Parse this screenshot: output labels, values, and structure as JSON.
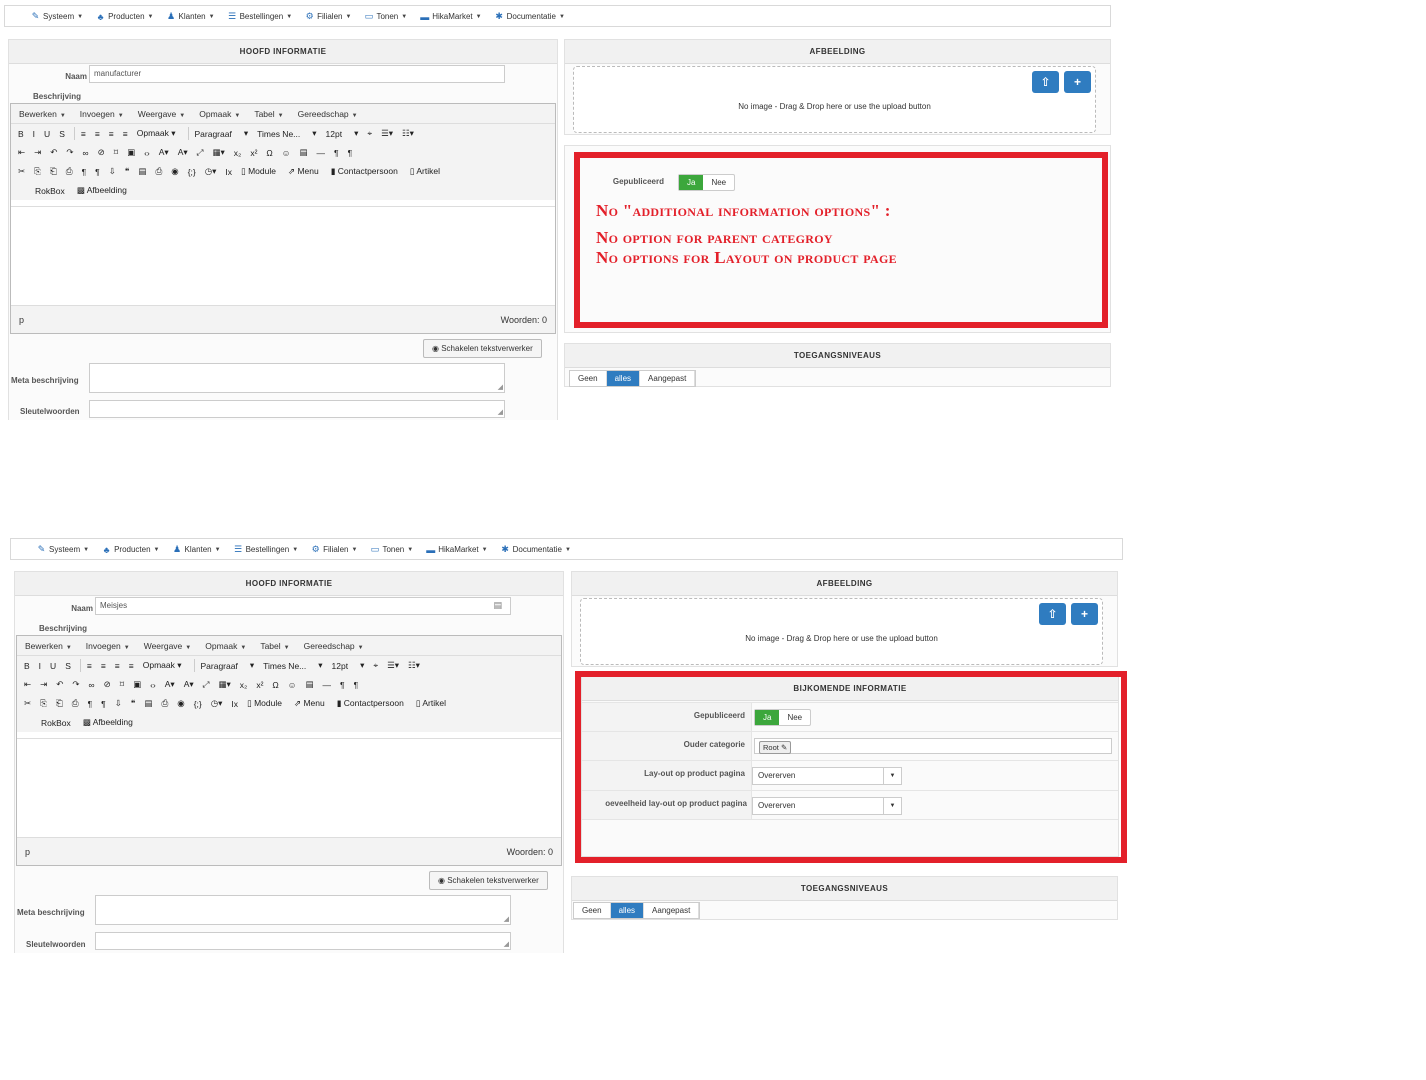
{
  "nav": [
    {
      "label": "Systeem",
      "icon": "wrench-icon",
      "glyph": "✎"
    },
    {
      "label": "Producten",
      "icon": "cubes-icon",
      "glyph": "♣"
    },
    {
      "label": "Klanten",
      "icon": "user-icon",
      "glyph": "♟"
    },
    {
      "label": "Bestellingen",
      "icon": "orders-icon",
      "glyph": "☰"
    },
    {
      "label": "Filialen",
      "icon": "stores-icon",
      "glyph": "⚙"
    },
    {
      "label": "Tonen",
      "icon": "monitor-icon",
      "glyph": "▭"
    },
    {
      "label": "HikaMarket",
      "icon": "market-icon",
      "glyph": "▬"
    },
    {
      "label": "Documentatie",
      "icon": "help-icon",
      "glyph": "✱"
    }
  ],
  "editor": {
    "menu": [
      "Bewerken",
      "Invoegen",
      "Weergave",
      "Opmaak",
      "Tabel",
      "Gereedschap"
    ],
    "row1": [
      {
        "g": "B",
        "n": "bold-icon"
      },
      {
        "g": "I",
        "n": "italic-icon"
      },
      {
        "g": "U",
        "n": "underline-icon"
      },
      {
        "g": "S",
        "n": "strikethrough-icon"
      },
      {
        "sep": true
      },
      {
        "g": "≡",
        "n": "align-left-icon"
      },
      {
        "g": "≡",
        "n": "align-center-icon"
      },
      {
        "g": "≡",
        "n": "align-right-icon"
      },
      {
        "g": "≡",
        "n": "align-justify-icon"
      },
      {
        "sel": "Opmaak ▾",
        "n": "format-select"
      },
      {
        "sep": true
      },
      {
        "sel": "Paragraaf",
        "n": "paragraph-select"
      },
      {
        "g": "▾",
        "n": "caret-icon"
      },
      {
        "sel": "Times Ne...",
        "n": "font-select"
      },
      {
        "g": "▾",
        "n": "caret-icon"
      },
      {
        "sel": "12pt",
        "n": "fontsize-select"
      },
      {
        "g": "▾",
        "n": "caret-icon"
      },
      {
        "g": "⌖",
        "n": "find-icon"
      },
      {
        "g": "☰▾",
        "n": "bullet-list-icon"
      },
      {
        "g": "☷▾",
        "n": "numbered-list-icon"
      }
    ],
    "row2": [
      {
        "g": "⇤",
        "n": "outdent-icon"
      },
      {
        "g": "⇥",
        "n": "indent-icon"
      },
      {
        "g": "↶",
        "n": "undo-icon"
      },
      {
        "g": "↷",
        "n": "redo-icon"
      },
      {
        "g": "∞",
        "n": "link-icon"
      },
      {
        "g": "⊘",
        "n": "unlink-icon"
      },
      {
        "g": "⌑",
        "n": "anchor-icon"
      },
      {
        "g": "▣",
        "n": "image-icon"
      },
      {
        "g": "‹›",
        "n": "code-icon"
      },
      {
        "g": "A▾",
        "n": "text-color-icon"
      },
      {
        "g": "A▾",
        "n": "bg-color-icon"
      },
      {
        "g": "⤢",
        "n": "fullscreen-icon"
      },
      {
        "g": "▦▾",
        "n": "table-icon"
      },
      {
        "g": "x₂",
        "n": "subscript-icon"
      },
      {
        "g": "x²",
        "n": "superscript-icon"
      },
      {
        "g": "Ω",
        "n": "special-char-icon"
      },
      {
        "g": "☺",
        "n": "emoticon-icon"
      },
      {
        "g": "▤",
        "n": "media-icon"
      },
      {
        "g": "—",
        "n": "hr-icon"
      },
      {
        "g": "¶",
        "n": "ltr-icon"
      },
      {
        "g": "¶",
        "n": "rtl-icon"
      }
    ],
    "row3": [
      {
        "g": "✂",
        "n": "cut-icon"
      },
      {
        "g": "⎘",
        "n": "copy-icon"
      },
      {
        "g": "⎗",
        "n": "paste-icon"
      },
      {
        "g": "⎙",
        "n": "paste-text-icon"
      },
      {
        "g": "¶",
        "n": "visual-blocks-icon"
      },
      {
        "g": "¶",
        "n": "nonbreaking-icon"
      },
      {
        "g": "⇩",
        "n": "insert-icon"
      },
      {
        "g": "❝",
        "n": "blockquote-icon"
      },
      {
        "g": "▤",
        "n": "template-icon"
      },
      {
        "g": "⎙",
        "n": "print-icon"
      },
      {
        "g": "◉",
        "n": "preview-icon"
      },
      {
        "g": "{;}",
        "n": "codesample-icon"
      },
      {
        "g": "◷▾",
        "n": "datetime-icon"
      },
      {
        "g": "Ix",
        "n": "clear-format-icon"
      },
      {
        "btn": "Module",
        "n": "module-button",
        "g": "▯"
      },
      {
        "btn": "Menu",
        "n": "menu-button",
        "g": "⇗"
      },
      {
        "btn": "Contactpersoon",
        "n": "contact-button",
        "g": "▮"
      },
      {
        "btn": "Artikel",
        "n": "article-button",
        "g": "▯"
      }
    ],
    "row4": [
      {
        "btn": "RokBox",
        "n": "rokbox-button",
        "g": ""
      },
      {
        "btn": "Afbeelding",
        "n": "afbeelding-button",
        "g": "▩"
      }
    ],
    "status_tag": "p",
    "words": "Woorden: 0"
  },
  "labels": {
    "main_header": "HOOFD INFORMATIE",
    "name": "Naam",
    "description": "Beschrijving",
    "meta": "Meta beschrijving",
    "keywords": "Sleutelwoorden",
    "toggle_editor": "Schakelen tekstverwerker",
    "image_header": "AFBEELDING",
    "no_image": "No image - Drag & Drop here or use the upload button",
    "published": "Gepubliceerd",
    "yes": "Ja",
    "no": "Nee",
    "access_header": "TOEGANGSNIVEAUS",
    "access_options": [
      "Geen",
      "alles",
      "Aangepast"
    ],
    "access_selected": "alles"
  },
  "top": {
    "name_value": "manufacturer",
    "annotation": [
      "No \"additional information options\" :",
      "No option for parent categroy",
      "No options for Layout on product page"
    ]
  },
  "bottom": {
    "name_value": "Meisjes",
    "extra_header": "BIJKOMENDE INFORMATIE",
    "parent_label": "Ouder categorie",
    "parent_value": "Root",
    "layout_label": "Lay-out op product pagina",
    "layout_value": "Overerven",
    "qty_layout_label": "oeveelheid lay-out op product pagina",
    "qty_layout_value": "Overerven"
  },
  "colors": {
    "annotation": "#e3202a",
    "primary": "#2f7cc0",
    "success": "#3ca73c"
  }
}
